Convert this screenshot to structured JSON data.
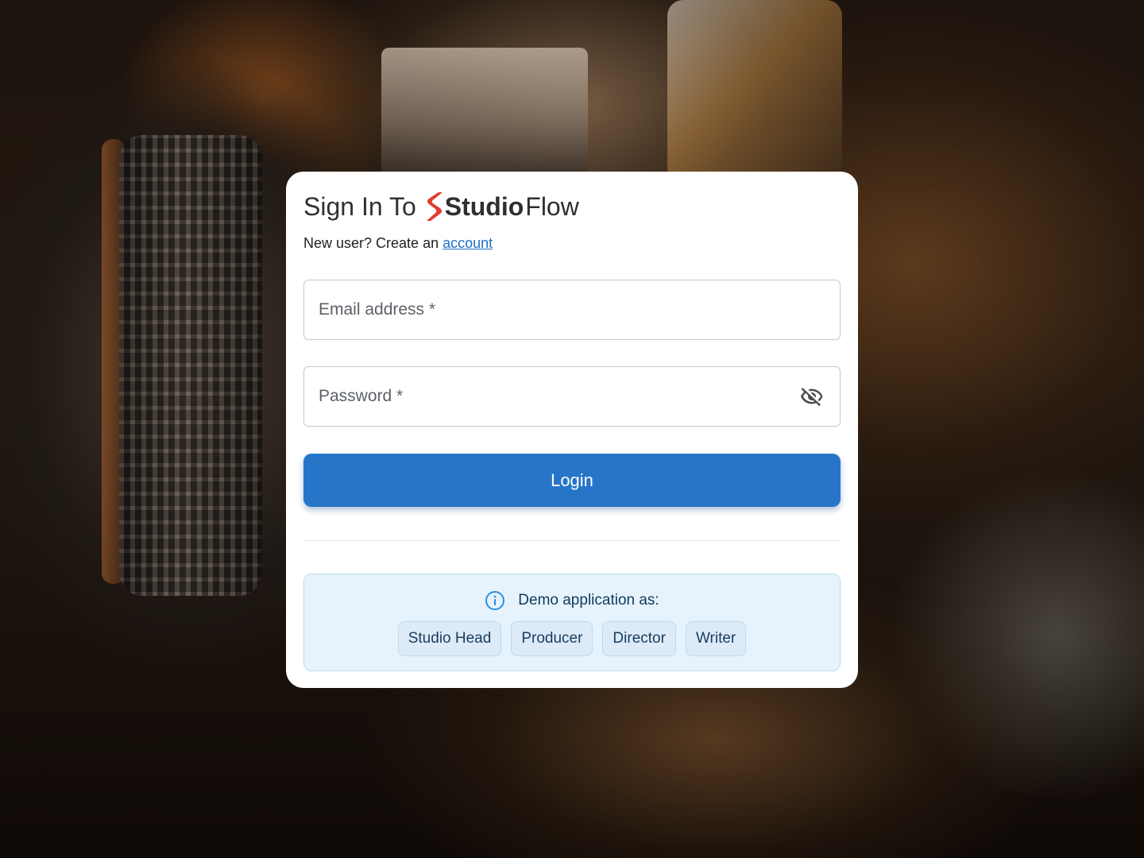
{
  "header": {
    "title_prefix": "Sign In To",
    "brand_strong": "Studio",
    "brand_light": "Flow",
    "brand_color": "#e23b2e"
  },
  "subtitle": {
    "text": "New user? Create an",
    "link_label": "account"
  },
  "form": {
    "email": {
      "placeholder": "Email address *",
      "value": ""
    },
    "password": {
      "placeholder": "Password *",
      "value": "",
      "toggle_icon": "eye-off-icon"
    },
    "login_label": "Login",
    "accent_color": "#2775c9"
  },
  "demo": {
    "heading": "Demo application as:",
    "icon": "info-icon",
    "roles": [
      "Studio Head",
      "Producer",
      "Director",
      "Writer"
    ]
  }
}
